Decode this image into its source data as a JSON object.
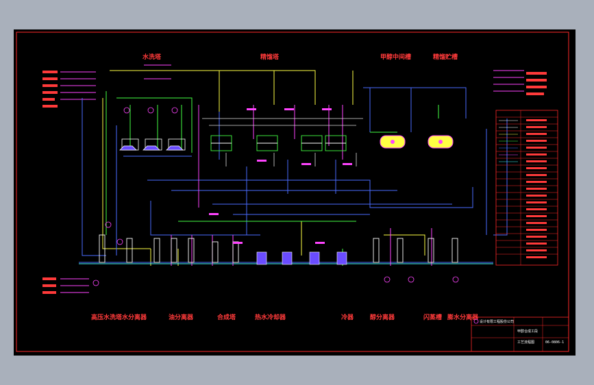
{
  "labels": {
    "top": [
      "水洗塔",
      "精馏塔",
      "甲醇中间槽",
      "精馏贮槽"
    ],
    "bottom": [
      "高压水洗塔水分离器",
      "油分离器",
      "合成塔",
      "热水冷却器",
      "冷器",
      "醇分离器",
      "闪蒸槽",
      "膨水分离器"
    ]
  },
  "title_block": {
    "company": "设计有限工程股份公司",
    "project": "甲醇合成工段",
    "drawing": "工艺流程图",
    "number": "06-0806-1"
  },
  "colors": {
    "background": "#000000",
    "frame": "#ff2a2a",
    "pipe_blue": "#4a6cff",
    "pipe_yellow": "#ffff44",
    "pipe_magenta": "#ff44ff",
    "pipe_green": "#44ff44",
    "pipe_cyan": "#44ffff",
    "equipment": "#ffffff"
  }
}
